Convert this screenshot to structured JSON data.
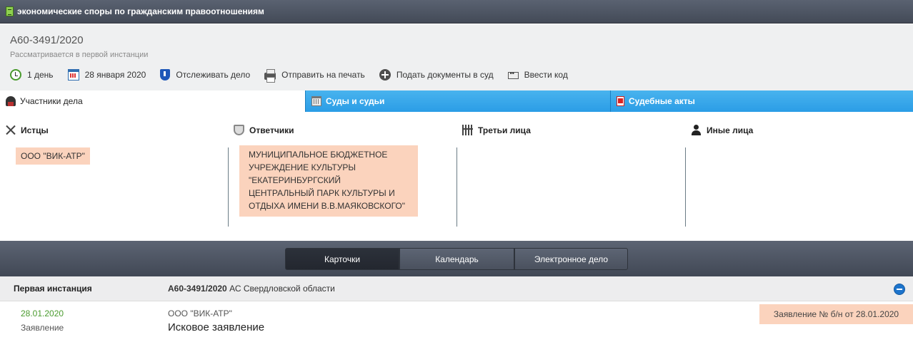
{
  "header": {
    "title": "экономические споры по гражданским правоотношениям"
  },
  "case": {
    "number": "А60-3491/2020",
    "status": "Рассматривается в первой инстанции"
  },
  "toolbar": [
    {
      "icon": "clock-icon",
      "label": "1 день"
    },
    {
      "icon": "calendar-icon",
      "label": "28 января 2020"
    },
    {
      "icon": "shield-icon",
      "label": "Отслеживать дело"
    },
    {
      "icon": "printer-icon",
      "label": "Отправить на печать"
    },
    {
      "icon": "plus-circle-icon",
      "label": "Подать документы в суд"
    },
    {
      "icon": "code-icon",
      "label": "Ввести код"
    }
  ],
  "tabs": [
    {
      "label": "Участники дела",
      "icon": "person-icon"
    },
    {
      "label": "Суды и судьи",
      "icon": "courthouse-icon"
    },
    {
      "label": "Судебные акты",
      "icon": "pdf-icon"
    }
  ],
  "participants": {
    "plaintiffs": {
      "label": "Истцы",
      "items": [
        "ООО \"ВИК-АТР\""
      ]
    },
    "defendants": {
      "label": "Ответчики",
      "items": [
        "МУНИЦИПАЛЬНОЕ БЮДЖЕТНОЕ УЧРЕЖДЕНИЕ КУЛЬТУРЫ \"ЕКАТЕРИНБУРГСКИЙ ЦЕНТРАЛЬНЫЙ ПАРК КУЛЬТУРЫ И ОТДЫХА ИМЕНИ В.В.МАЯКОВСКОГО\""
      ]
    },
    "third_parties": {
      "label": "Третьи лица",
      "items": []
    },
    "others": {
      "label": "Иные лица",
      "items": []
    }
  },
  "view_switch": [
    "Карточки",
    "Календарь",
    "Электронное дело"
  ],
  "instance": {
    "title": "Первая инстанция",
    "case_number": "А60-3491/2020",
    "court": "АС Свердловской области"
  },
  "document": {
    "date": "28.01.2020",
    "type": "Заявление",
    "party": "ООО \"ВИК-АТР\"",
    "title": "Исковое заявление",
    "badge": "Заявление № б/н от 28.01.2020"
  },
  "colors": {
    "accent_blue": "#2b9de6",
    "highlight_peach": "#fbd3bd",
    "date_green": "#4a9b2e"
  }
}
